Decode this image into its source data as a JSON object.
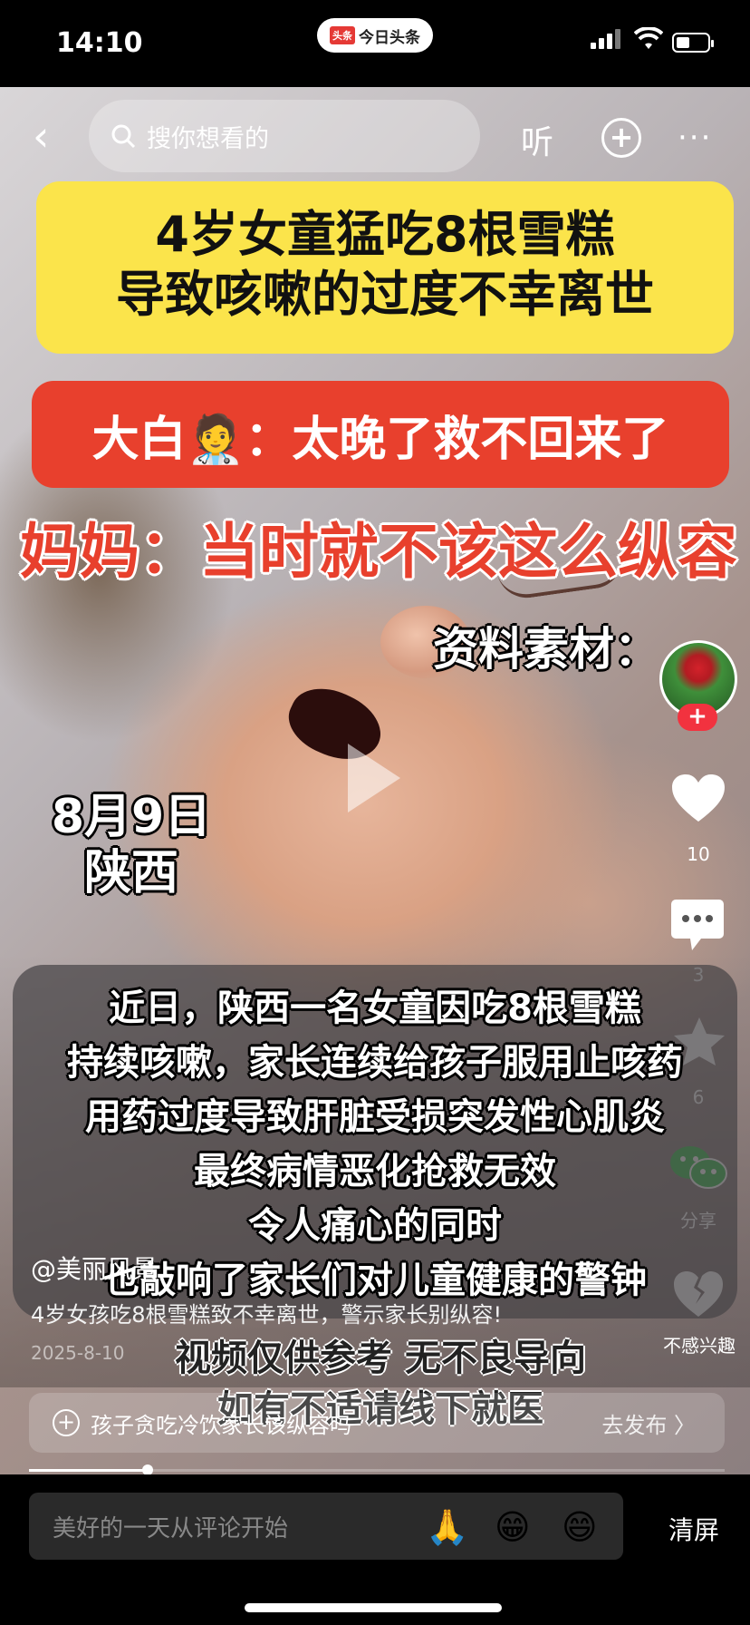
{
  "status": {
    "time": "14:10",
    "app_badge_logo": "头条",
    "app_badge_name": "今日头条"
  },
  "topbar": {
    "search_placeholder": "搜你想看的",
    "listen_label": "听",
    "add_icon": "plus-circle-icon",
    "more_label": "···"
  },
  "video": {
    "headline_line1": "4岁女童猛吃8根雪糕",
    "headline_line2": "导致咳嗽的过度不幸离世",
    "doctor_quote": "大白🧑‍⚕️：太晚了救不回来了",
    "mother_quote": "妈妈：当时就不该这么纵容",
    "source_label": "资料素材：",
    "date": "8月9日",
    "location": "陕西",
    "caption_lines": [
      "近日，陕西一名女童因吃8根雪糕",
      "持续咳嗽，家长连续给孩子服用止咳药",
      "用药过度导致肝脏受损突发性心肌炎",
      "最终病情恶化抢救无效",
      "令人痛心的同时",
      "也敲响了家长们对儿童健康的警钟"
    ],
    "disclaimer_line1": "视频仅供参考 无不良导向",
    "disclaimer_line2": "如有不适请线下就医",
    "progress_fraction": 0.17
  },
  "rail": {
    "like_count": "10",
    "comment_count": "3",
    "favorite_count": "6",
    "share_label": "分享",
    "dislike_label": "不感兴趣"
  },
  "post": {
    "author": "@美丽风景",
    "title": "4岁女孩吃8根雪糕致不幸离世，警示家长别纵容!",
    "date": "2025-8-10"
  },
  "topic": {
    "text": "孩子贪吃冷饮家长该纵容吗",
    "action": "去发布 〉"
  },
  "bottom": {
    "comment_placeholder": "美好的一天从评论开始",
    "emoji1": "🙏",
    "emoji2": "😁",
    "emoji3": "😄",
    "clear_label": "清屏"
  }
}
